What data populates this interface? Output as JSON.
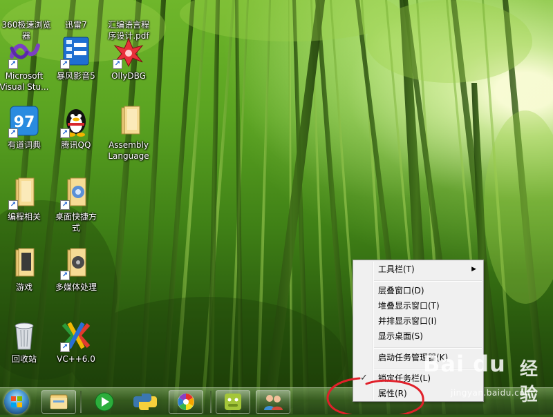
{
  "desktop": {
    "icons": [
      {
        "label": "360极速浏览\n器",
        "icon": "browser-icon"
      },
      {
        "label": "迅雷7",
        "icon": "thunder-icon"
      },
      {
        "label": "汇编语言程\n序设计.pdf",
        "icon": "pdf-icon"
      },
      {
        "label": "Microsoft\nVisual Stu...",
        "icon": "visual-studio-icon"
      },
      {
        "label": "暴风影音5",
        "icon": "media-player-icon"
      },
      {
        "label": "OllyDBG",
        "icon": "debugger-icon"
      },
      {
        "label": "有道词典",
        "icon": "dictionary-icon"
      },
      {
        "label": "腾讯QQ",
        "icon": "qq-penguin-icon"
      },
      {
        "label": "Assembly\nLanguage",
        "icon": "folder-icon"
      },
      {
        "label": "编程相关",
        "icon": "folder-icon"
      },
      {
        "label": "桌面快捷方\n式",
        "icon": "folder-icon"
      },
      {
        "label": "游戏",
        "icon": "folder-icon"
      },
      {
        "label": "多媒体处理",
        "icon": "folder-icon"
      },
      {
        "label": "回收站",
        "icon": "recycle-bin-icon"
      },
      {
        "label": "VC++6.0",
        "icon": "vc-icon"
      }
    ]
  },
  "taskbar": {
    "start_icon": "windows-start-icon",
    "pinned": [
      {
        "icon": "file-explorer-icon"
      },
      {
        "icon": "media-play-icon"
      },
      {
        "icon": "python-icon"
      },
      {
        "icon": "color-wheel-icon"
      },
      {
        "icon": "android-icon"
      },
      {
        "icon": "users-icon"
      }
    ]
  },
  "context_menu": {
    "toolbars": "工具栏(T)",
    "cascade": "层叠窗口(D)",
    "stacked": "堆叠显示窗口(T)",
    "side_by_side": "并排显示窗口(I)",
    "show_desktop": "显示桌面(S)",
    "task_manager": "启动任务管理器(K)",
    "lock_taskbar": "锁定任务栏(L)",
    "properties": "属性(R)",
    "submenu_arrow": "▶",
    "check_mark": "✓"
  },
  "watermark": {
    "brand": "Bai du",
    "jingyan": "经验",
    "url": "jingyan.baidu.com"
  },
  "colors": {
    "annotation_red": "#e0202a",
    "menu_bg": "#f0f0f0"
  }
}
